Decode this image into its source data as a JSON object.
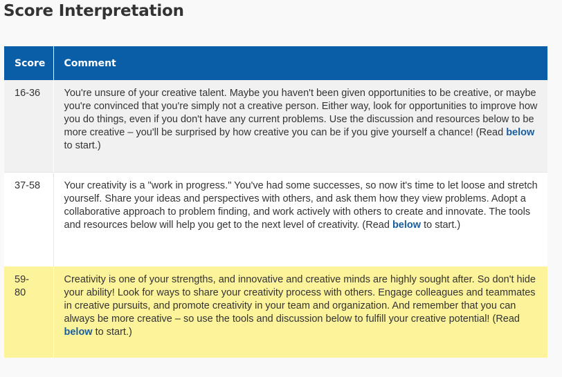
{
  "title": "Score Interpretation",
  "table": {
    "headers": {
      "score": "Score",
      "comment": "Comment"
    },
    "rows": [
      {
        "score": "16-36",
        "comment_text": "You're unsure of your creative talent. Maybe you haven't been given opportunities to be creative, or maybe you're convinced that you're simply not a creative person. Either way, look for opportunities to improve how you do things, even if you don't have any current problems. Use the discussion and resources below to be more creative – you'll be surprised by how creative you can be if you give yourself a chance! (Read",
        "link_label": "below",
        "comment_tail": "to start.)"
      },
      {
        "score": "37-58",
        "comment_text": "Your creativity is a \"work in progress.\" You've had some successes, so now it's time to let loose and stretch yourself. Share your ideas and perspectives with others, and ask them how they view problems. Adopt a collaborative approach to problem finding, and work actively with others to create and innovate. The tools and resources below will help you get to the next level of creativity. (Read",
        "link_label": "below",
        "comment_tail": "to start.)"
      },
      {
        "score": "59-80",
        "comment_text": "Creativity is one of your strengths, and innovative and creative minds are highly sought after. So don't hide your ability! Look for ways to share your creativity process with others. Engage colleagues and teammates in creative pursuits, and promote creativity in your team and organization. And remember that you can always be more creative – so use the tools and discussion below to fulfill your creative potential! (Read",
        "link_label": "below",
        "comment_tail": "to start.)"
      }
    ]
  },
  "colors": {
    "header_bg": "#0a5ea8",
    "row_gray": "#f1f1f1",
    "row_white": "#ffffff",
    "row_highlight": "#fcf39a",
    "link": "#1a5d9e"
  }
}
